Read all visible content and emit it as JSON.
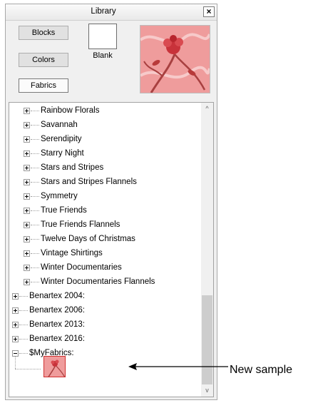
{
  "window": {
    "title": "Library",
    "close_symbol": "×"
  },
  "buttons": {
    "blocks": "Blocks",
    "colors": "Colors",
    "fabrics": "Fabrics"
  },
  "blank_label": "Blank",
  "tree": {
    "children": [
      "Rainbow Florals",
      "Savannah",
      "Serendipity",
      "Starry Night",
      "Stars and Stripes",
      "Stars and Stripes Flannels",
      "Symmetry",
      "True Friends",
      "True Friends Flannels",
      "Twelve Days of Christmas",
      "Vintage Shirtings",
      "Winter Documentaries",
      "Winter Documentaries Flannels"
    ],
    "groups": [
      "Benartex 2004:",
      "Benartex 2006:",
      "Benartex 2013:",
      "Benartex 2016:"
    ],
    "myfabrics": "$MyFabrics:"
  },
  "scroll": {
    "up_arrow": "^",
    "down_arrow": "v"
  },
  "annotation": "New sample",
  "colors": {
    "fabric_pink": "#e88a8a",
    "fabric_red": "#c8323a"
  }
}
